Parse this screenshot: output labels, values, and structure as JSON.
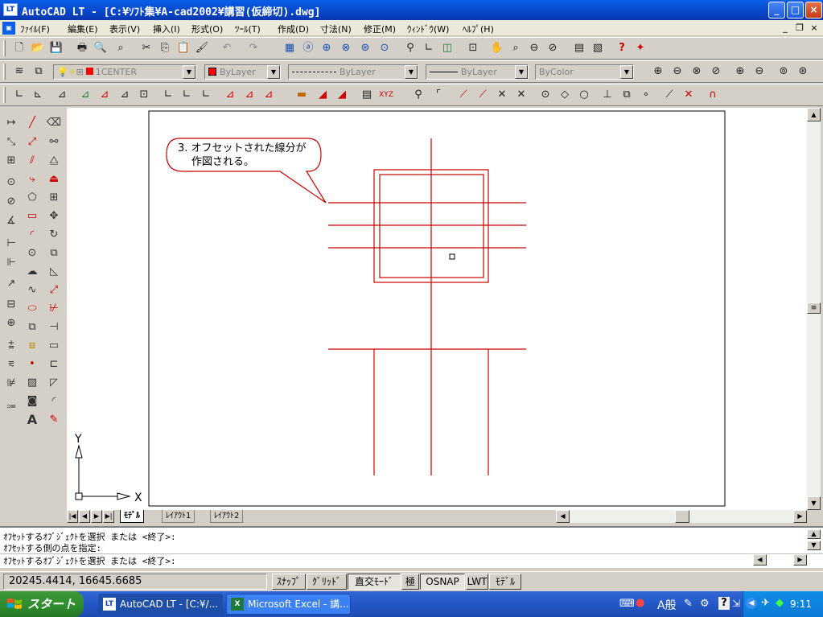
{
  "window": {
    "title": "AutoCAD LT - [C:¥ｿﾌﾄ集¥A-cad2002¥講習(仮締切).dwg]",
    "app_icon_label": "LT",
    "controls": {
      "minimize": "_",
      "maximize": "□",
      "close": "×"
    }
  },
  "menubar": {
    "items": [
      "ﾌｧｲﾙ(F)",
      "編集(E)",
      "表示(V)",
      "挿入(I)",
      "形式(O)",
      "ﾂｰﾙ(T)",
      "作成(D)",
      "寸法(N)",
      "修正(M)",
      "ｳｨﾝﾄﾞｳ(W)",
      "ﾍﾙﾌﾟ(H)"
    ],
    "mdi": {
      "minimize": "_",
      "restore": "❐",
      "close": "×"
    }
  },
  "properties_toolbar": {
    "layer_value": "1CENTER",
    "color_value": "ByLayer",
    "linetype_value": "ByLayer",
    "lineweight_value": "ByLayer",
    "plotstyle_value": "ByColor",
    "swatch_color": "#ff0000"
  },
  "drawing": {
    "callout_text_line1": "3. オフセットされた線分が",
    "callout_text_line2": "作図される。",
    "line_color": "#cc0000",
    "ucs_x_label": "X",
    "ucs_y_label": "Y"
  },
  "layout_tabs": [
    "ﾓﾃﾞﾙ",
    "ﾚｲｱｳﾄ1",
    "ﾚｲｱｳﾄ2"
  ],
  "command_window": {
    "lines": [
      "ｵﾌｾｯﾄするｵﾌﾞｼﾞｪｸﾄを選択 または <終了>:",
      "ｵﾌｾｯﾄする側の点を指定:",
      "ｵﾌｾｯﾄするｵﾌﾞｼﾞｪｸﾄを選択 または <終了>:"
    ]
  },
  "statusbar": {
    "coordinates": "20245.4414, 16645.6685",
    "buttons": [
      {
        "label": "ｽﾅｯﾌﾟ",
        "on": false
      },
      {
        "label": "ｸﾞﾘｯﾄﾞ",
        "on": false
      },
      {
        "label": "直交ﾓｰﾄﾞ",
        "on": true
      },
      {
        "label": "極",
        "on": false
      },
      {
        "label": "OSNAP",
        "on": true
      },
      {
        "label": "LWT",
        "on": false
      },
      {
        "label": "ﾓﾃﾞﾙ",
        "on": false
      }
    ]
  },
  "taskbar": {
    "start_label": "スタート",
    "tasks": [
      {
        "label": "AutoCAD LT - [C:¥/...",
        "icon": "LT",
        "active": true
      },
      {
        "label": "Microsoft Excel - 講...",
        "icon": "X",
        "active": false
      }
    ],
    "ime_label": "A般",
    "clock": "9:11"
  }
}
